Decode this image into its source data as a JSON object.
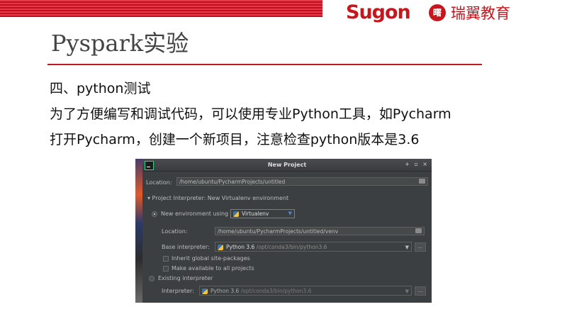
{
  "header": {
    "brand": "Sugon",
    "logo_glyph": "曙",
    "partner": "瑞翼教育",
    "accent_color": "#c8161d"
  },
  "slide": {
    "title": "Pyspark实验",
    "lines": [
      "四、python测试",
      "为了方便编写和调试代码，可以使用专业Python工具，如Pycharm",
      "打开Pycharm，创建一个新项目，注意检查python版本是3.6"
    ]
  },
  "dialog": {
    "title": "New Project",
    "window_buttons": "+ ▫ ×",
    "location_label": "Location:",
    "location_value": "/home/ubuntu/PycharmProjects/untitled",
    "section_label": "▾ Project Interpreter: New Virtualenv environment",
    "new_env_label": "New environment using",
    "env_tool": "Virtualenv",
    "venv_location_label": "Location:",
    "venv_location_value": "/home/ubuntu/PycharmProjects/untitled/venv",
    "base_interpreter_label": "Base interpreter:",
    "base_interpreter_version": "Python 3.6",
    "base_interpreter_path": "/opt/conda3/bin/python3.6",
    "inherit_label": "Inherit global site-packages",
    "make_available_label": "Make available to all projects",
    "existing_label": "Existing interpreter",
    "interpreter_label": "Interpreter:",
    "interpreter_version": "Python 3.6",
    "interpreter_path": "/opt/conda3/bin/python3.6",
    "more_button": "..."
  }
}
